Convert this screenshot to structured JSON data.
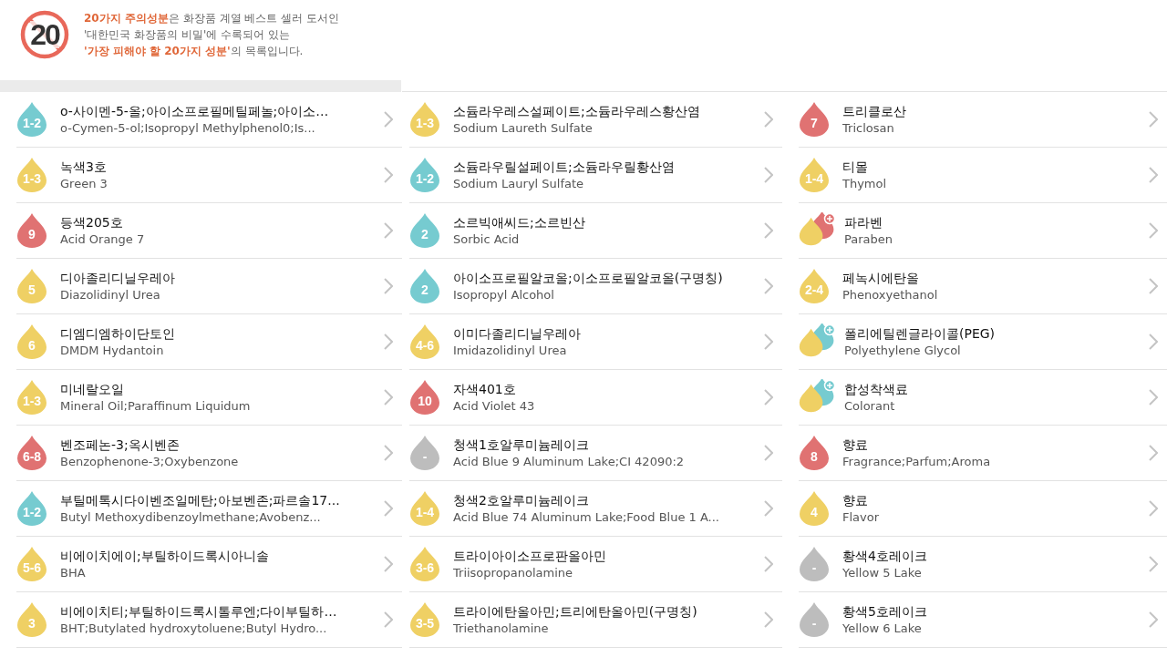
{
  "header": {
    "sign_text": "20",
    "lines": [
      "**20가지 주의성분**은 화장품 계열 베스트 셀러 도서인",
      "'대한민국 화장품의 비밀'에 수록되어 있는",
      "**'가장 피해야 할 20가지 성분'**의 목록입니다."
    ]
  },
  "columns": [
    {
      "items": [
        {
          "kind": "drop",
          "score": "1-2",
          "color": "#76cbd0",
          "name": "o-사이멘-5-올;아이소프로필메틸페놀;아이소…",
          "name_en": "o-Cymen-5-ol;Isopropyl Methylphenol0;Is..."
        },
        {
          "kind": "drop",
          "score": "1-3",
          "color": "#efd064",
          "name": "녹색3호",
          "name_en": "Green 3"
        },
        {
          "kind": "drop",
          "score": "9",
          "color": "#e07272",
          "name": "등색205호",
          "name_en": "Acid Orange 7"
        },
        {
          "kind": "drop",
          "score": "5",
          "color": "#efd064",
          "name": "디아졸리디닐우레아",
          "name_en": "Diazolidinyl Urea"
        },
        {
          "kind": "drop",
          "score": "6",
          "color": "#efd064",
          "name": "디엠디엠하이단토인",
          "name_en": "DMDM Hydantoin"
        },
        {
          "kind": "drop",
          "score": "1-3",
          "color": "#efd064",
          "name": "미네랄오일",
          "name_en": "Mineral Oil;Paraffinum Liquidum"
        },
        {
          "kind": "drop",
          "score": "6-8",
          "color": "#e07272",
          "name": "벤조페논-3;옥시벤존",
          "name_en": "Benzophenone-3;Oxybenzone"
        },
        {
          "kind": "drop",
          "score": "1-2",
          "color": "#76cbd0",
          "name": "부틸메톡시다이벤조일메탄;아보벤존;파르솔17...",
          "name_en": "Butyl Methoxydibenzoylmethane;Avobenz..."
        },
        {
          "kind": "drop",
          "score": "5-6",
          "color": "#efd064",
          "name": "비에이치에이;부틸하이드록시아니솔",
          "name_en": "BHA"
        },
        {
          "kind": "drop",
          "score": "3",
          "color": "#efd064",
          "name": "비에이치티;부틸하이드록시톨루엔;다이부틸하…",
          "name_en": "BHT;Butylated hydroxytoluene;Butyl Hydro..."
        }
      ]
    },
    {
      "items": [
        {
          "kind": "drop",
          "score": "1-3",
          "color": "#efd064",
          "name": "소듐라우레스설페이트;소듐라우레스황산염",
          "name_en": "Sodium Laureth Sulfate"
        },
        {
          "kind": "drop",
          "score": "1-2",
          "color": "#76cbd0",
          "name": "소듐라우릴설페이트;소듐라우릴황산염",
          "name_en": "Sodium Lauryl Sulfate"
        },
        {
          "kind": "drop",
          "score": "2",
          "color": "#76cbd0",
          "name": "소르빅애씨드;소르빈산",
          "name_en": "Sorbic Acid"
        },
        {
          "kind": "drop",
          "score": "2",
          "color": "#76cbd0",
          "name": "아이소프로필알코올;이소프로필알코올(구명칭)",
          "name_en": "Isopropyl Alcohol"
        },
        {
          "kind": "drop",
          "score": "4-6",
          "color": "#efd064",
          "name": "이미다졸리디닐우레아",
          "name_en": "Imidazolidinyl Urea"
        },
        {
          "kind": "drop",
          "score": "10",
          "color": "#e07272",
          "name": "자색401호",
          "name_en": "Acid Violet 43"
        },
        {
          "kind": "drop",
          "score": "-",
          "color": "#bdbdbd",
          "name": "청색1호알루미늄레이크",
          "name_en": "Acid Blue 9 Aluminum Lake;CI 42090:2"
        },
        {
          "kind": "drop",
          "score": "1-4",
          "color": "#efd064",
          "name": "청색2호알루미늄레이크",
          "name_en": "Acid Blue 74 Aluminum Lake;Food Blue 1 A..."
        },
        {
          "kind": "drop",
          "score": "3-6",
          "color": "#efd064",
          "name": "트라이아이소프로판올아민",
          "name_en": "Triisopropanolamine"
        },
        {
          "kind": "drop",
          "score": "3-5",
          "color": "#efd064",
          "name": "트라이에탄올아민;트리에탄올아민(구명칭)",
          "name_en": "Triethanolamine"
        }
      ]
    },
    {
      "items": [
        {
          "kind": "drop",
          "score": "7",
          "color": "#e07272",
          "name": "트리클로산",
          "name_en": "Triclosan"
        },
        {
          "kind": "drop",
          "score": "1-4",
          "color": "#efd064",
          "name": "티몰",
          "name_en": "Thymol"
        },
        {
          "kind": "group",
          "color": "#e07272",
          "name": "파라벤",
          "name_en": "Paraben"
        },
        {
          "kind": "drop",
          "score": "2-4",
          "color": "#efd064",
          "name": "페녹시에탄올",
          "name_en": "Phenoxyethanol"
        },
        {
          "kind": "group",
          "color": "#76cbd0",
          "name": "폴리에틸렌글라이콜(PEG)",
          "name_en": "Polyethylene Glycol"
        },
        {
          "kind": "group",
          "color": "#76cbd0",
          "name": "합성착색료",
          "name_en": "Colorant"
        },
        {
          "kind": "drop",
          "score": "8",
          "color": "#e07272",
          "name": "향료",
          "name_en": "Fragrance;Parfum;Aroma"
        },
        {
          "kind": "drop",
          "score": "4",
          "color": "#efd064",
          "name": "향료",
          "name_en": "Flavor"
        },
        {
          "kind": "drop",
          "score": "-",
          "color": "#bdbdbd",
          "name": "황색4호레이크",
          "name_en": "Yellow 5 Lake"
        },
        {
          "kind": "drop",
          "score": "-",
          "color": "#bdbdbd",
          "name": "황색5호레이크",
          "name_en": "Yellow 6 Lake"
        }
      ]
    }
  ]
}
